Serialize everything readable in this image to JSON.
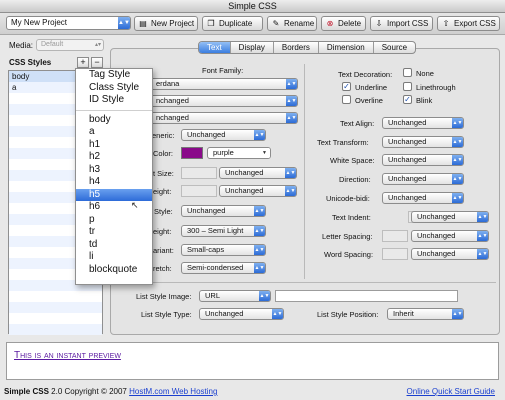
{
  "window": {
    "title": "Simple CSS"
  },
  "toolbar": {
    "project": "My New Project",
    "buttons": {
      "new_project": "New Project",
      "duplicate": "Duplicate",
      "rename": "Rename",
      "delete": "Delete",
      "import_css": "Import CSS",
      "export_css": "Export CSS"
    }
  },
  "sidebar": {
    "media_label": "Media:",
    "media_value": "Default",
    "css_styles_label": "CSS Styles",
    "plus": "+",
    "minus": "−",
    "styles": [
      "body",
      "a"
    ]
  },
  "tabs": [
    "Text",
    "Display",
    "Borders",
    "Dimension",
    "Source"
  ],
  "left_props": {
    "font_family_label": "Font Family:",
    "font_family_value": "erdana",
    "row2_value": "nchanged",
    "row3_value": "nchanged",
    "generic_label": "eneric:",
    "generic_value": "Unchanged",
    "color_label": "Color:",
    "color_value": "purple",
    "size_label": "t Size:",
    "size_value": "Unchanged",
    "height_label": "eight:",
    "height_value": "Unchanged",
    "style_label": "Style:",
    "style_value": "Unchanged",
    "weight_label": "eight:",
    "weight_value": "300 – Semi Light",
    "variant_label": "ariant:",
    "variant_value": "Small-caps",
    "stretch_label": "retch:",
    "stretch_value": "Semi-condensed"
  },
  "right_props": {
    "decoration_label": "Text Decoration:",
    "none": "None",
    "underline": "Underline",
    "linethrough": "Linethrough",
    "overline": "Overline",
    "blink": "Blink",
    "text_align_label": "Text Align:",
    "text_align_value": "Unchanged",
    "text_transform_label": "Text Transform:",
    "text_transform_value": "Unchanged",
    "white_space_label": "White Space:",
    "white_space_value": "Unchanged",
    "direction_label": "Direction:",
    "direction_value": "Unchanged",
    "unicode_bidi_label": "Unicode-bidi:",
    "unicode_bidi_value": "Unchanged",
    "text_indent_label": "Text Indent:",
    "text_indent_value": "Unchanged",
    "letter_spacing_label": "Letter Spacing:",
    "letter_spacing_value": "Unchanged",
    "word_spacing_label": "Word Spacing:",
    "word_spacing_value": "Unchanged"
  },
  "list_props": {
    "image_label": "List Style Image:",
    "image_value": "URL",
    "type_label": "List Style Type:",
    "type_value": "Unchanged",
    "position_label": "List Style Position:",
    "position_value": "Inherit"
  },
  "preview": {
    "text": "This is an instant preview"
  },
  "footer": {
    "app": "Simple CSS",
    "version": "2.0 Copyright © 2007",
    "link": "HostM.com Web Hosting",
    "guide": "Online Quick Start Guide"
  },
  "popup_menu": {
    "group1": [
      "Tag Style",
      "Class Style",
      "ID Style"
    ],
    "group2": [
      "body",
      "a",
      "h1",
      "h2",
      "h3",
      "h4",
      "h5",
      "h6",
      "p",
      "tr",
      "td",
      "li",
      "blockquote"
    ],
    "highlighted": "h5"
  },
  "colors": {
    "purple_swatch": "#8a0a8a",
    "accent": "#2c6bd6"
  }
}
